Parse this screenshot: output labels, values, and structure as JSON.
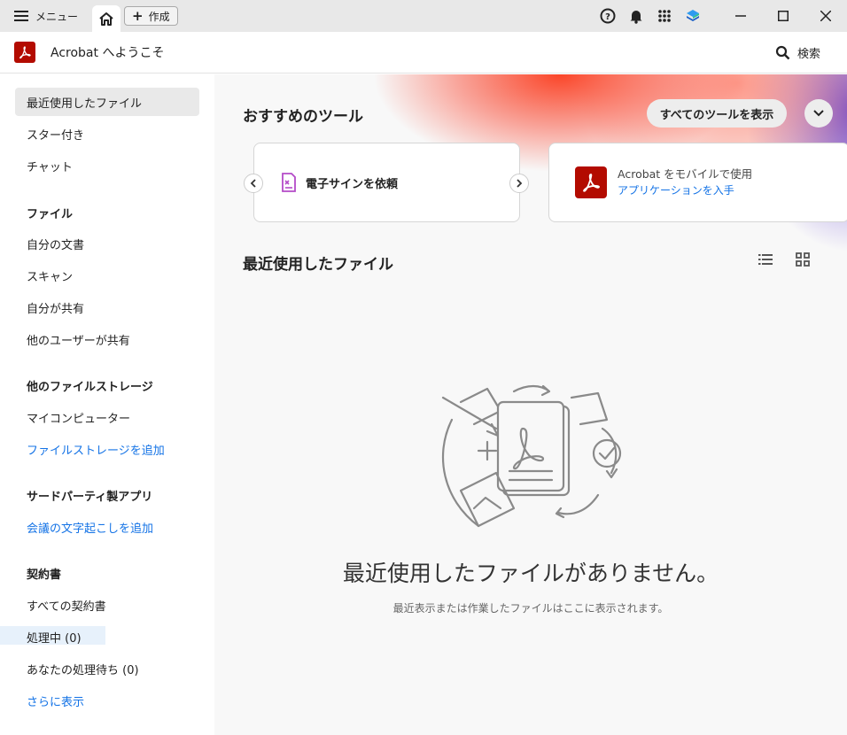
{
  "titlebar": {
    "menu_label": "メニュー",
    "create_label": "作成",
    "icons": [
      "help-icon",
      "bell-icon",
      "apps-grid-icon",
      "layers-icon"
    ],
    "window_controls": [
      "minimize",
      "maximize",
      "close"
    ]
  },
  "header": {
    "title": "Acrobat へようこそ",
    "search_label": "検索"
  },
  "sidebar": {
    "items_top": [
      {
        "label": "最近使用したファイル",
        "active": true
      },
      {
        "label": "スター付き"
      },
      {
        "label": "チャット"
      }
    ],
    "sections": [
      {
        "heading": "ファイル",
        "items": [
          "自分の文書",
          "スキャン",
          "自分が共有",
          "他のユーザーが共有"
        ]
      },
      {
        "heading": "他のファイルストレージ",
        "items": [
          "マイコンピューター"
        ],
        "link": "ファイルストレージを追加"
      },
      {
        "heading": "サードパーティ製アプリ",
        "link": "会議の文字起こしを追加"
      },
      {
        "heading": "契約書",
        "items": [
          "すべての契約書",
          "処理中 (0)",
          "あなたの処理待ち (0)"
        ],
        "link": "さらに表示"
      }
    ]
  },
  "main": {
    "tools_title": "おすすめのツール",
    "all_tools_label": "すべてのツールを表示",
    "tool_card_label": "電子サインを依頼",
    "mobile_card": {
      "text": "Acrobat をモバイルで使用",
      "link": "アプリケーションを入手"
    },
    "recent_title": "最近使用したファイル",
    "empty_title": "最近使用したファイルがありません。",
    "empty_subtitle": "最近表示または作業したファイルはここに表示されます。"
  },
  "colors": {
    "brand_red": "#b30b00",
    "link_blue": "#1473e6",
    "active_bg": "#e9e9e9"
  }
}
